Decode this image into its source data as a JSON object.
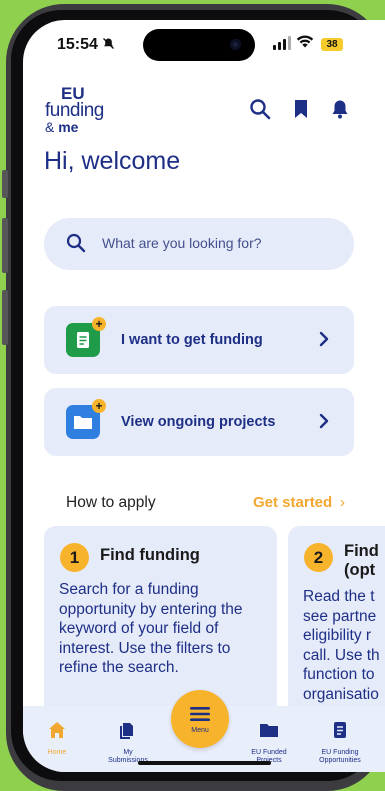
{
  "status_bar": {
    "time": "15:54",
    "battery": "38"
  },
  "logo": {
    "line1": "EU",
    "line2": "funding",
    "line3_amp": "&",
    "line3_me": "me"
  },
  "header": {
    "icons": [
      "search-icon",
      "bookmark-icon",
      "bell-icon"
    ]
  },
  "greeting": "Hi, welcome",
  "search": {
    "placeholder": "What are you looking for?"
  },
  "cards": [
    {
      "label": "I want to get funding",
      "icon": "document-icon",
      "icon_color": "#1f9b4a"
    },
    {
      "label": "View ongoing projects",
      "icon": "folder-icon",
      "icon_color": "#2f7fe0"
    }
  ],
  "how_to_apply": {
    "heading": "How to apply",
    "link": "Get started",
    "link_chevron": "›"
  },
  "steps": [
    {
      "number": "1",
      "title": "Find funding",
      "body": "Search for a funding opportunity by entering the keyword of your field of interest. Use the filters to refine the search."
    },
    {
      "number": "2",
      "title": "Find",
      "title_line2": "(opt",
      "body_lines": [
        "Read the t",
        "see partne",
        "eligibility r",
        "call. Use th",
        "function to",
        "organisatio"
      ]
    }
  ],
  "bottom_nav": [
    {
      "label": "Home",
      "icon": "home-icon",
      "active": true
    },
    {
      "label_line1": "My",
      "label_line2": "Submissions",
      "icon": "submissions-icon"
    },
    {
      "label": "Menu",
      "icon": "menu-icon"
    },
    {
      "label_line1": "EU Funded",
      "label_line2": "Projects",
      "icon": "folder-icon"
    },
    {
      "label_line1": "EU Funding",
      "label_line2": "Opportunities",
      "icon": "document-icon"
    }
  ],
  "colors": {
    "brand": "#1e2f86",
    "accent": "#f7b32b",
    "card_bg": "#e6ebf9",
    "background": "#8fd14f"
  }
}
